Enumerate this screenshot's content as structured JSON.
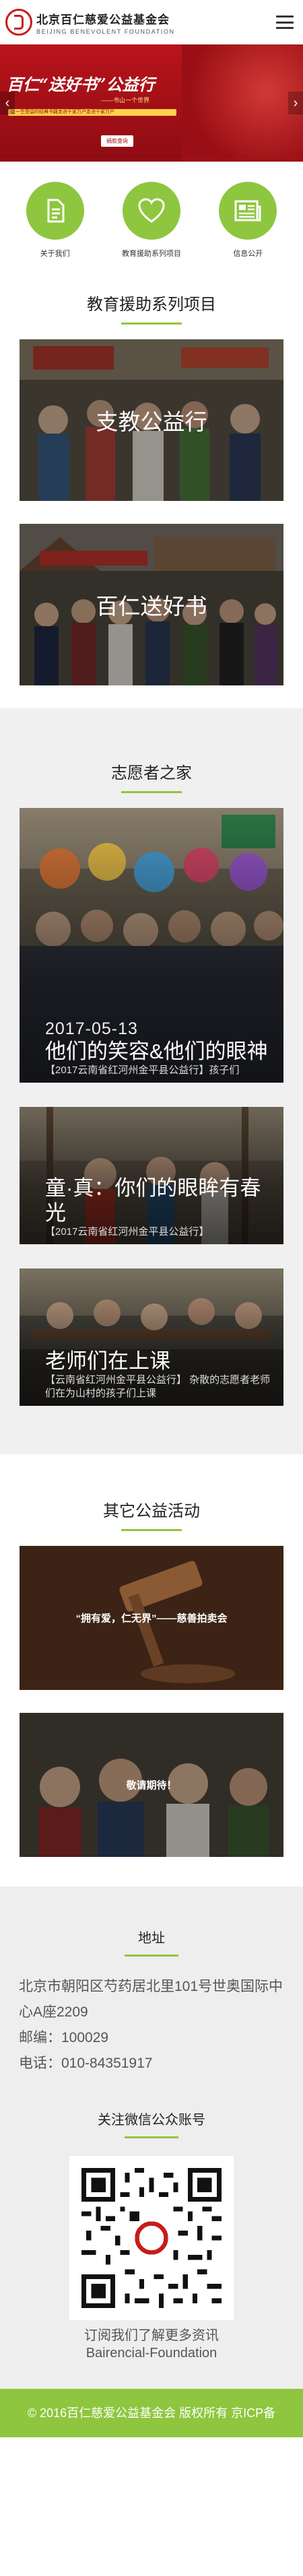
{
  "header": {
    "logo_cn": "北京百仁慈爱公益基金会",
    "logo_en": "BEIJING BENEVOLENT FOUNDATION",
    "menu_icon": "hamburger-icon"
  },
  "banner": {
    "title": "百仁“送好书”公益行",
    "subtitle": "——书山一个世界",
    "ribbon": "让一生受益的经典书籍走进千家万户走进千家万户",
    "button": "捐款查询",
    "prev_icon": "chevron-left-icon",
    "next_icon": "chevron-right-icon"
  },
  "quick_links": [
    {
      "label": "关于我们",
      "icon": "document-icon"
    },
    {
      "label": "教育援助系列项目",
      "icon": "heart-icon"
    },
    {
      "label": "信息公开",
      "icon": "news-icon"
    }
  ],
  "education": {
    "title": "教育援助系列项目",
    "cards": [
      {
        "title": "支教公益行"
      },
      {
        "title": "百仁送好书"
      }
    ]
  },
  "volunteers": {
    "title": "志愿者之家",
    "cards": [
      {
        "date": "2017-05-13",
        "title": "他们的笑容&他们的眼神",
        "desc": "【2017云南省红河州金平县公益行】孩子们"
      },
      {
        "date": "",
        "title": "童·真：你们的眼眸有春光",
        "desc": "【2017云南省红河州金平县公益行】"
      },
      {
        "date": "",
        "title": "老师们在上课",
        "desc": "【云南省红河州金平县公益行】 杂散的志愿者老师们在为山村的孩子们上课"
      }
    ]
  },
  "activities": {
    "title": "其它公益活动",
    "cards": [
      {
        "text": "“拥有爱，仁无界”——慈善拍卖会"
      },
      {
        "text": "敬请期待！"
      }
    ]
  },
  "footer": {
    "address_title": "地址",
    "address": "北京市朝阳区芍药居北里101号世奥国际中心A座2209",
    "postcode": "邮编：100029",
    "phone": "电话：010-84351917",
    "wechat_title": "关注微信公众账号",
    "qr_caption_1": "订阅我们了解更多资讯",
    "qr_caption_2": "Bairencial-Foundation",
    "copyright": "© 2016百仁慈爱公益基金会 版权所有 京ICP备"
  },
  "colors": {
    "accent_green": "#8ec63f",
    "brand_red": "#c81b1b"
  }
}
